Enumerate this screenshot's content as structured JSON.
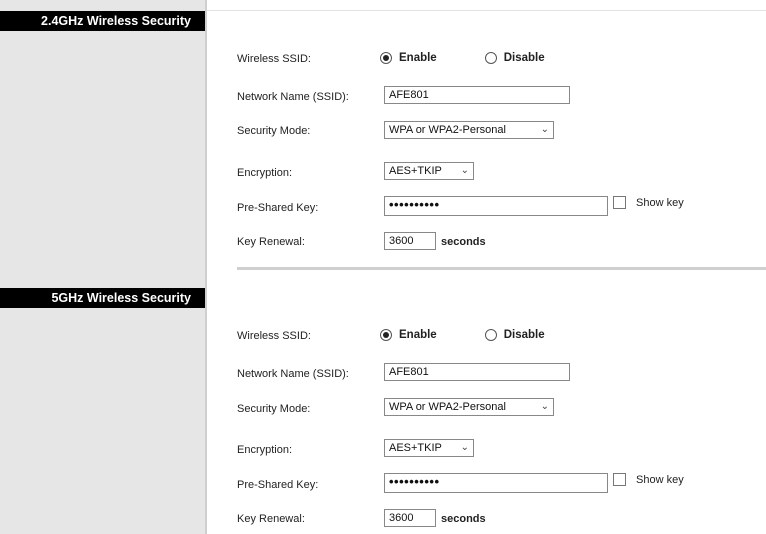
{
  "sections": [
    {
      "title": "2.4GHz Wireless Security",
      "wireless_ssid_label": "Wireless SSID:",
      "enable_label": "Enable",
      "disable_label": "Disable",
      "enable_selected": true,
      "network_name_label": "Network Name (SSID):",
      "network_name_value": "AFE801",
      "security_mode_label": "Security Mode:",
      "security_mode_value": "WPA or WPA2-Personal",
      "encryption_label": "Encryption:",
      "encryption_value": "AES+TKIP",
      "psk_label": "Pre-Shared Key:",
      "psk_value": "••••••••••",
      "show_key_label": "Show key",
      "show_key_checked": false,
      "key_renewal_label": "Key Renewal:",
      "key_renewal_value": "3600",
      "seconds_label": "seconds"
    },
    {
      "title": "5GHz Wireless Security",
      "wireless_ssid_label": "Wireless SSID:",
      "enable_label": "Enable",
      "disable_label": "Disable",
      "enable_selected": true,
      "network_name_label": "Network Name (SSID):",
      "network_name_value": "AFE801",
      "security_mode_label": "Security Mode:",
      "security_mode_value": "WPA or WPA2-Personal",
      "encryption_label": "Encryption:",
      "encryption_value": "AES+TKIP",
      "psk_label": "Pre-Shared Key:",
      "psk_value": "••••••••••",
      "show_key_label": "Show key",
      "show_key_checked": false,
      "key_renewal_label": "Key Renewal:",
      "key_renewal_value": "3600",
      "seconds_label": "seconds"
    }
  ],
  "icons": {
    "chevron": "chevron-down-icon",
    "radio": "radio-icon",
    "checkbox": "checkbox-icon"
  }
}
